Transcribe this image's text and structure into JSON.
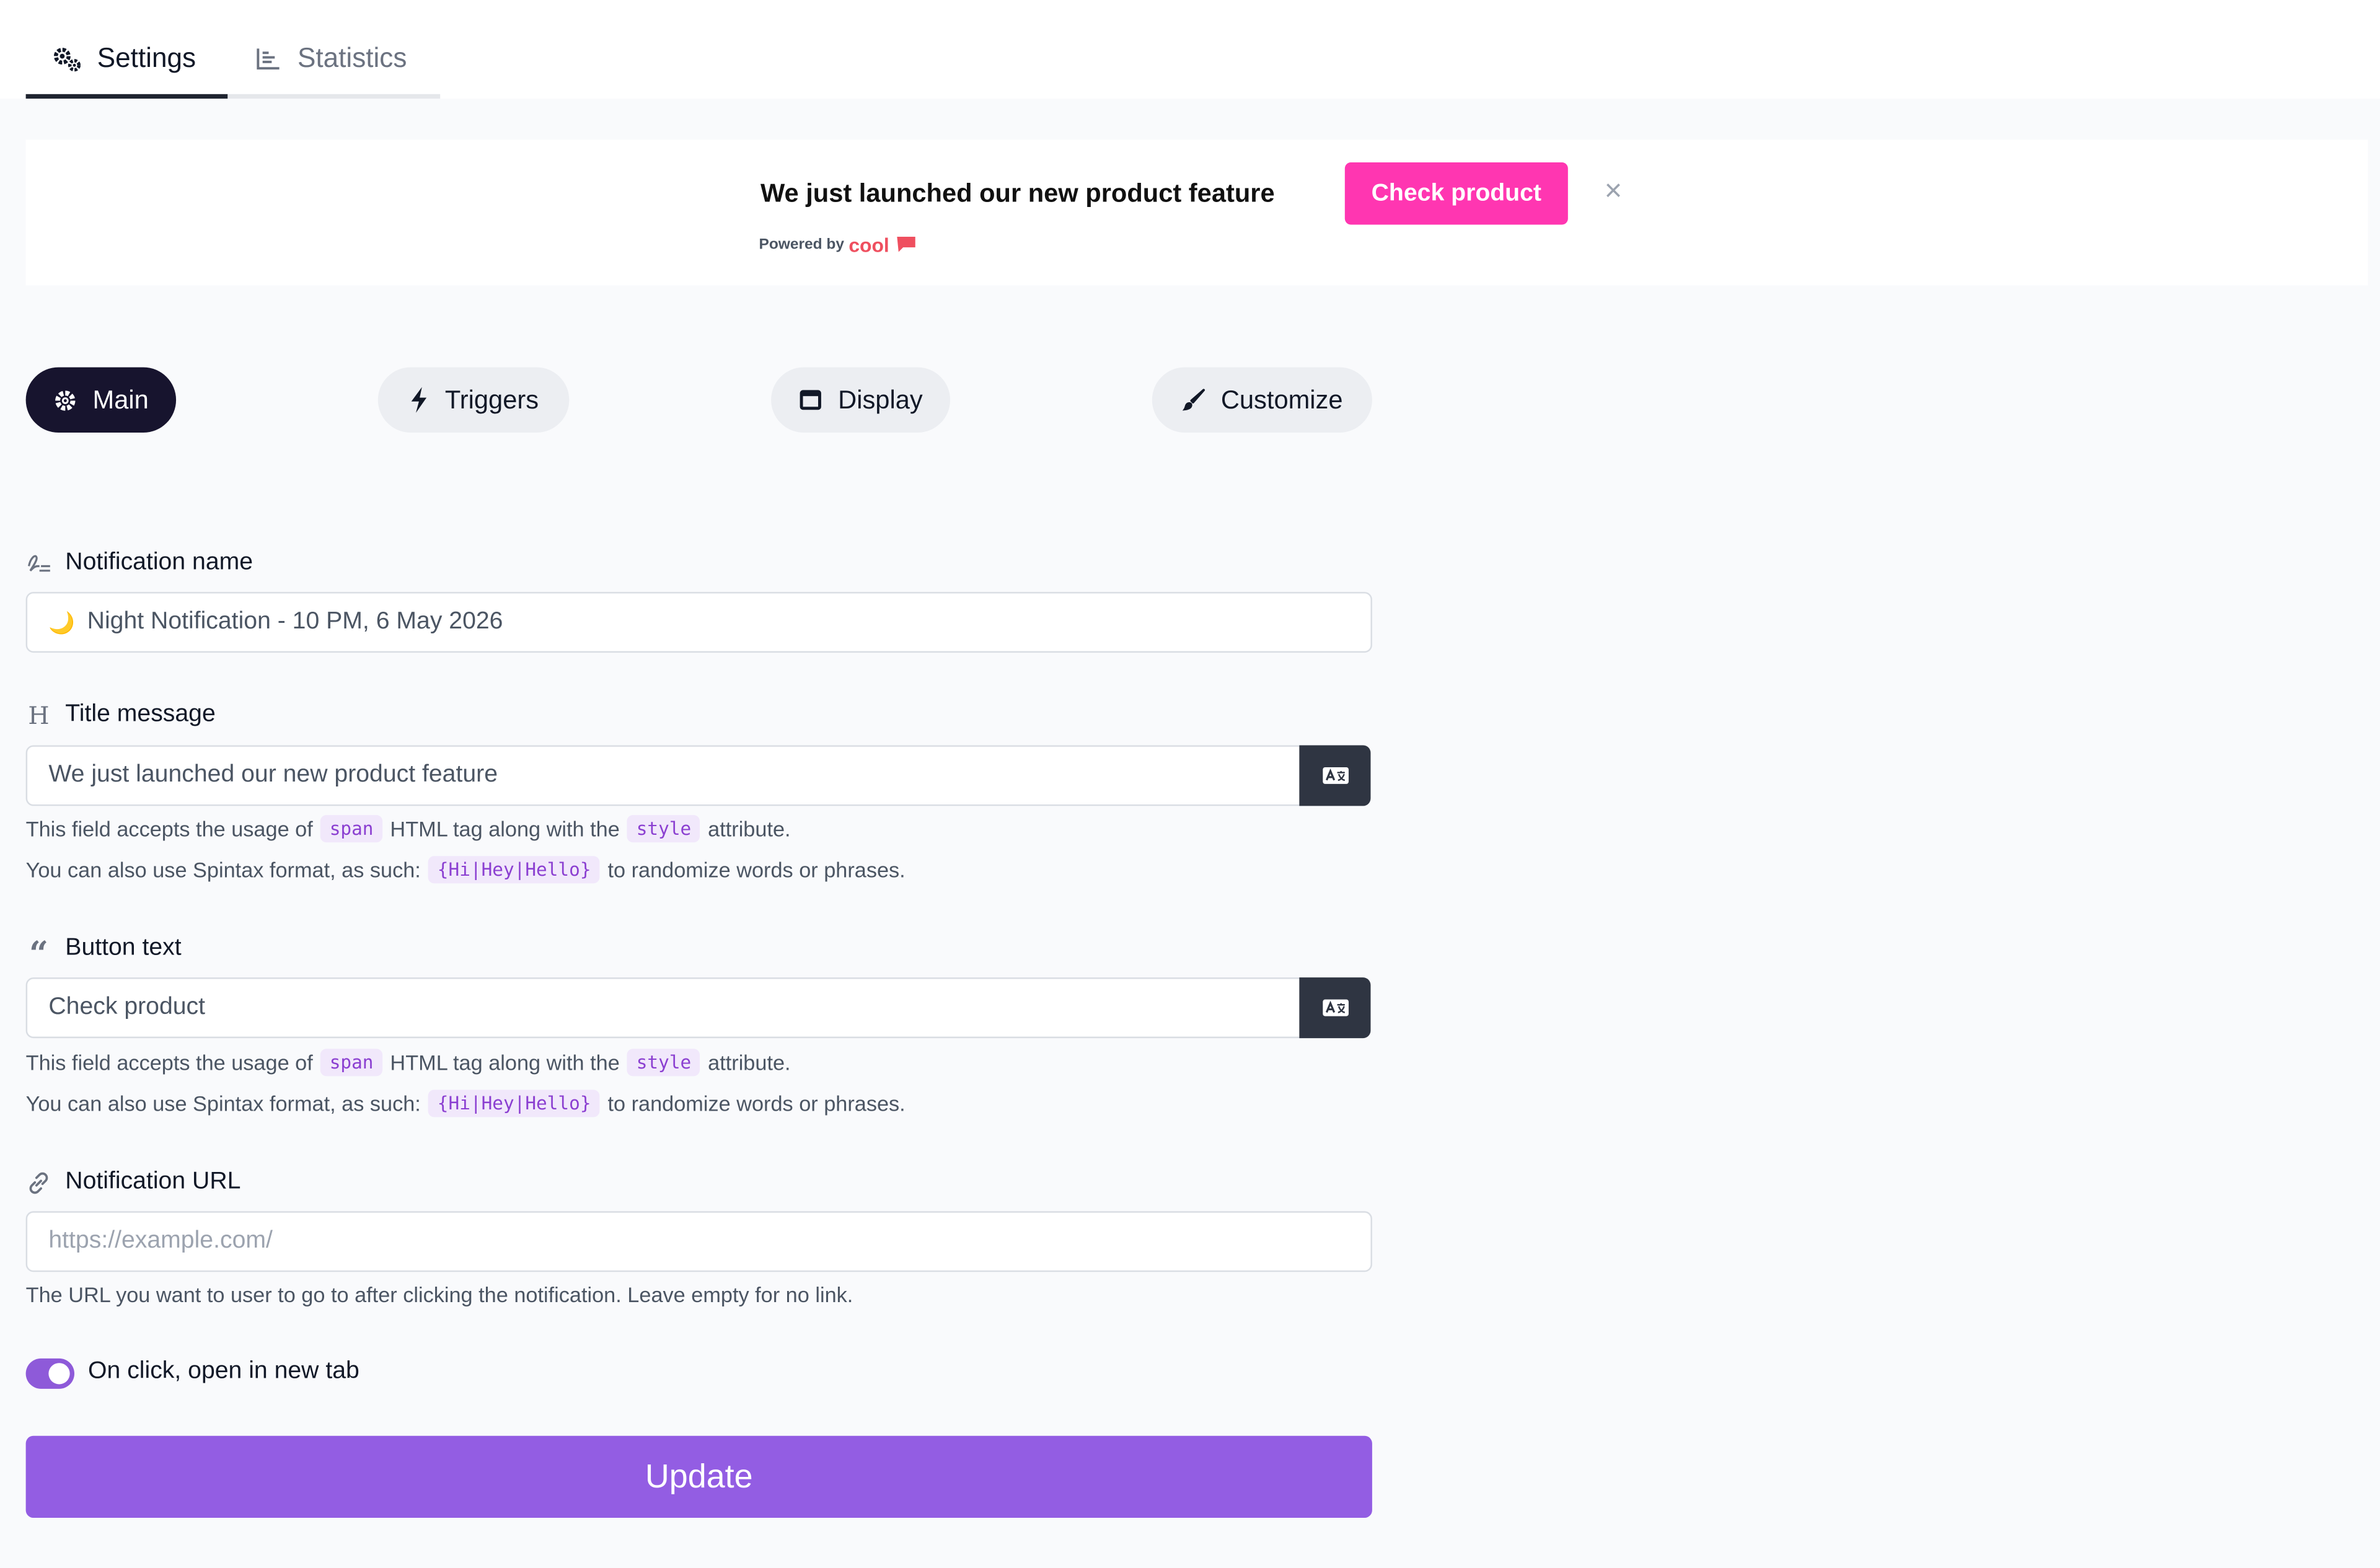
{
  "tabs": {
    "settings": "Settings",
    "statistics": "Statistics"
  },
  "banner": {
    "title": "We just launched our new product feature",
    "powered_by": "Powered by",
    "brand": "cool",
    "button": "Check product",
    "close": "×"
  },
  "pills": {
    "main": "Main",
    "triggers": "Triggers",
    "display": "Display",
    "customize": "Customize"
  },
  "form": {
    "name": {
      "label": "Notification name",
      "emoji": "🌙",
      "value": "Night Notification - 10 PM, 6 May 2026"
    },
    "title": {
      "label": "Title message",
      "value": "We just launched our new product feature"
    },
    "button_text": {
      "label": "Button text",
      "value": "Check product"
    },
    "help": {
      "accepts_prefix": "This field accepts the usage of",
      "span_code": "span",
      "accepts_mid": "HTML tag along with the",
      "style_code": "style",
      "accepts_suffix": "attribute.",
      "spintax_prefix": "You can also use Spintax format, as such:",
      "spintax_code": "{Hi|Hey|Hello}",
      "spintax_suffix": "to randomize words or phrases."
    },
    "url": {
      "label": "Notification URL",
      "placeholder": "https://example.com/",
      "help": "The URL you want to user to go to after clicking the notification. Leave empty for no link."
    },
    "new_tab": {
      "label": "On click, open in new tab",
      "checked": true
    },
    "submit": "Update"
  },
  "colors": {
    "accent": "#935de3",
    "banner_button": "#ff36b1",
    "dark_pill": "#17142e"
  }
}
